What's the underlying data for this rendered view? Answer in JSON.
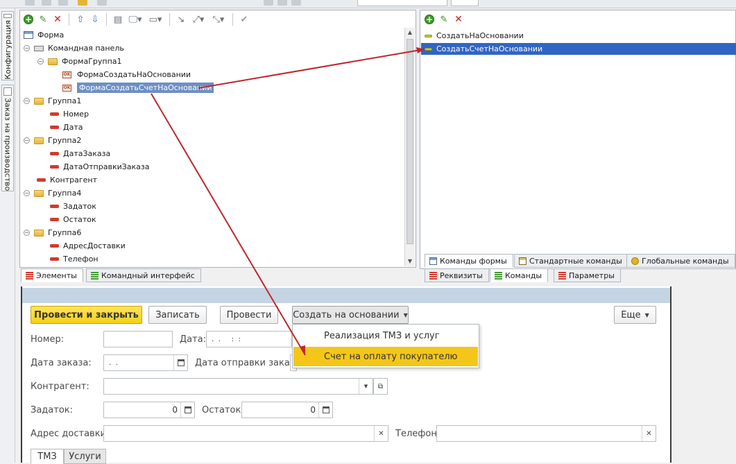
{
  "left_tabs": [
    {
      "label": "Конфигурация"
    },
    {
      "label": "Заказ на производство"
    }
  ],
  "elements_tree": {
    "nodes": [
      {
        "label": "Форма"
      },
      {
        "label": "Командная панель"
      },
      {
        "label": "ФормаГруппа1"
      },
      {
        "label": "ФормаСоздатьНаОсновании"
      },
      {
        "label": "ФормаСоздатьСчетНаОсновании",
        "selected": true
      },
      {
        "label": "Группа1"
      },
      {
        "label": "Номер"
      },
      {
        "label": "Дата"
      },
      {
        "label": "Группа2"
      },
      {
        "label": "ДатаЗаказа"
      },
      {
        "label": "ДатаОтправкиЗаказа"
      },
      {
        "label": "Контрагент"
      },
      {
        "label": "Группа4"
      },
      {
        "label": "Задаток"
      },
      {
        "label": "Остаток"
      },
      {
        "label": "Группа6"
      },
      {
        "label": "АдресДоставки"
      },
      {
        "label": "Телефон"
      }
    ],
    "ok_badge": "OK"
  },
  "left_bottom_tabs": [
    {
      "label": "Элементы",
      "active": true
    },
    {
      "label": "Командный интерфейс",
      "active": false
    }
  ],
  "commands_list": [
    {
      "label": "СоздатьНаОсновании"
    },
    {
      "label": "СоздатьСчетНаОсновании",
      "selected": true
    }
  ],
  "right_tabs_row1": [
    {
      "label": "Команды формы",
      "active": true
    },
    {
      "label": "Стандартные команды",
      "active": false
    },
    {
      "label": "Глобальные команды",
      "active": false
    }
  ],
  "right_tabs_row2": [
    {
      "label": "Реквизиты",
      "active": false
    },
    {
      "label": "Команды",
      "active": true
    },
    {
      "label": "Параметры",
      "active": false
    }
  ],
  "form": {
    "buttons": {
      "post_close": "Провести и закрыть",
      "save": "Записать",
      "post": "Провести",
      "create_based": "Создать на основании",
      "more": "Еще"
    },
    "dropdown": [
      {
        "label": "Реализация ТМЗ и услуг",
        "highlighted": false
      },
      {
        "label": "Счет на оплату покупателю",
        "highlighted": true
      }
    ],
    "fields": {
      "number_label": "Номер:",
      "date_label": "Дата:",
      "date_value": " .  .     :  :",
      "order_date_label": "Дата заказа:",
      "order_date_value": " .  .",
      "ship_date_label": "Дата отправки заказа:",
      "counterparty_label": "Контрагент:",
      "deposit_label": "Задаток:",
      "deposit_value": "0",
      "balance_label": "Остаток:",
      "balance_value": "0",
      "address_label": "Адрес доставки:",
      "phone_label": "Телефон:"
    },
    "tabs": [
      {
        "label": "ТМЗ",
        "active": true
      },
      {
        "label": "Услуги",
        "active": false
      }
    ]
  },
  "colors": {
    "accent_yellow": "#f5cf16",
    "selection_blue": "#6d8fc4",
    "arrow_red": "#c0262b"
  }
}
